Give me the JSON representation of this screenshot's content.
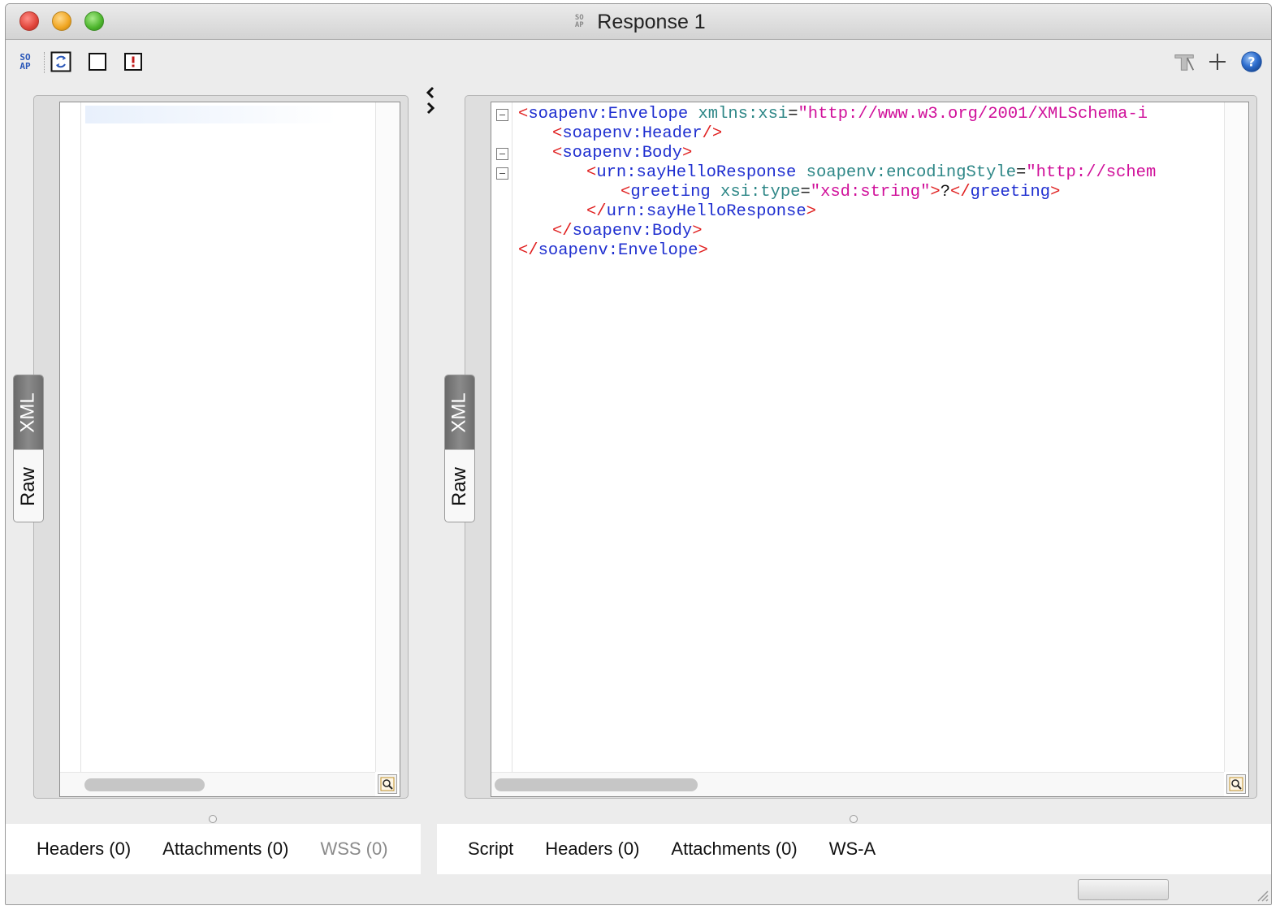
{
  "window": {
    "title": "Response 1",
    "title_badge": [
      "SO",
      "AP"
    ]
  },
  "toolbar": {
    "soap_badge": [
      "SO",
      "AP"
    ]
  },
  "request_panel": {
    "view_tabs": {
      "active": "XML",
      "inactive": "Raw"
    },
    "bottom_tabs": [
      {
        "label": "Headers (0)",
        "enabled": true
      },
      {
        "label": "Attachments (0)",
        "enabled": true
      },
      {
        "label": "WSS (0)",
        "enabled": false
      }
    ]
  },
  "response_panel": {
    "view_tabs": {
      "active": "XML",
      "inactive": "Raw"
    },
    "xml_lines": [
      {
        "indent": 0,
        "fold": true,
        "parts": [
          [
            "br",
            "<"
          ],
          [
            "tag",
            "soapenv:Envelope"
          ],
          [
            "txt",
            " "
          ],
          [
            "attr",
            "xmlns:xsi"
          ],
          [
            "eq",
            "="
          ],
          [
            "val",
            "\"http://www.w3.org/2001/XMLSchema-i"
          ]
        ]
      },
      {
        "indent": 1,
        "fold": false,
        "parts": [
          [
            "br",
            "<"
          ],
          [
            "tag",
            "soapenv:Header"
          ],
          [
            "br",
            "/>"
          ]
        ]
      },
      {
        "indent": 1,
        "fold": true,
        "parts": [
          [
            "br",
            "<"
          ],
          [
            "tag",
            "soapenv:Body"
          ],
          [
            "br",
            ">"
          ]
        ]
      },
      {
        "indent": 2,
        "fold": true,
        "parts": [
          [
            "br",
            "<"
          ],
          [
            "tag",
            "urn:sayHelloResponse"
          ],
          [
            "txt",
            " "
          ],
          [
            "attr",
            "soapenv:encodingStyle"
          ],
          [
            "eq",
            "="
          ],
          [
            "val",
            "\"http://schem"
          ]
        ]
      },
      {
        "indent": 3,
        "fold": false,
        "parts": [
          [
            "br",
            "<"
          ],
          [
            "tag",
            "greeting"
          ],
          [
            "txt",
            " "
          ],
          [
            "attr",
            "xsi:type"
          ],
          [
            "eq",
            "="
          ],
          [
            "val",
            "\"xsd:string\""
          ],
          [
            "br",
            ">"
          ],
          [
            "txt",
            "?"
          ],
          [
            "br",
            "</"
          ],
          [
            "tag",
            "greeting"
          ],
          [
            "br",
            ">"
          ]
        ]
      },
      {
        "indent": 2,
        "fold": false,
        "parts": [
          [
            "br",
            "</"
          ],
          [
            "tag",
            "urn:sayHelloResponse"
          ],
          [
            "br",
            ">"
          ]
        ]
      },
      {
        "indent": 1,
        "fold": false,
        "parts": [
          [
            "br",
            "</"
          ],
          [
            "tag",
            "soapenv:Body"
          ],
          [
            "br",
            ">"
          ]
        ]
      },
      {
        "indent": 0,
        "fold": false,
        "parts": [
          [
            "br",
            "</"
          ],
          [
            "tag",
            "soapenv:Envelope"
          ],
          [
            "br",
            ">"
          ]
        ]
      }
    ],
    "bottom_tabs": [
      {
        "label": "Script",
        "enabled": true
      },
      {
        "label": "Headers (0)",
        "enabled": true
      },
      {
        "label": "Attachments (0)",
        "enabled": true
      },
      {
        "label": "WS-A",
        "enabled": true
      }
    ]
  },
  "colors": {
    "xml_bracket": "#e02020",
    "xml_tag": "#1f2fd0",
    "xml_attr": "#2e8787",
    "xml_value": "#d0109a",
    "soap_icon_blue": "#2a57b8"
  },
  "icons": {
    "toolbar_left": [
      "soap-icon",
      "refresh-icon",
      "square-icon",
      "alert-icon"
    ],
    "toolbar_right": [
      "tab-icon",
      "plus-icon",
      "help-icon"
    ]
  }
}
